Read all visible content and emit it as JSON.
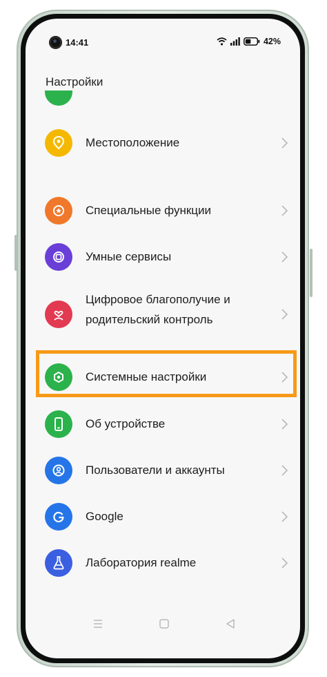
{
  "status_bar": {
    "time": "14:41",
    "battery_percent": "42%",
    "icons": [
      "wifi-icon",
      "signal-icon",
      "battery-icon"
    ]
  },
  "header": {
    "title": "Настройки"
  },
  "settings": {
    "items": [
      {
        "label": "Местоположение",
        "icon": "location-pin-icon",
        "color": "#f5b800"
      },
      {
        "label": "Специальные функции",
        "icon": "accessibility-star-icon",
        "color": "#f0782b"
      },
      {
        "label": "Умные сервисы",
        "icon": "smart-services-icon",
        "color": "#6a3fd8"
      },
      {
        "label_line1": "Цифровое благополучие и",
        "label_line2": "родительский контроль",
        "icon": "heart-person-icon",
        "color": "#e23a50"
      },
      {
        "label": "Системные настройки",
        "icon": "system-gear-icon",
        "color": "#2bb24c",
        "highlighted": true
      },
      {
        "label": "Об устройстве",
        "icon": "phone-device-icon",
        "color": "#2bb24c"
      },
      {
        "label": "Пользователи и аккаунты",
        "icon": "user-account-icon",
        "color": "#2575e8"
      },
      {
        "label": "Google",
        "icon": "google-g-icon",
        "color": "#2575e8"
      },
      {
        "label": "Лаборатория realme",
        "icon": "lab-flask-icon",
        "color": "#3a5fe0"
      }
    ]
  },
  "highlight_color": "#f79a18",
  "nav_bar": {
    "buttons": [
      "menu-icon",
      "home-icon",
      "back-icon"
    ]
  }
}
